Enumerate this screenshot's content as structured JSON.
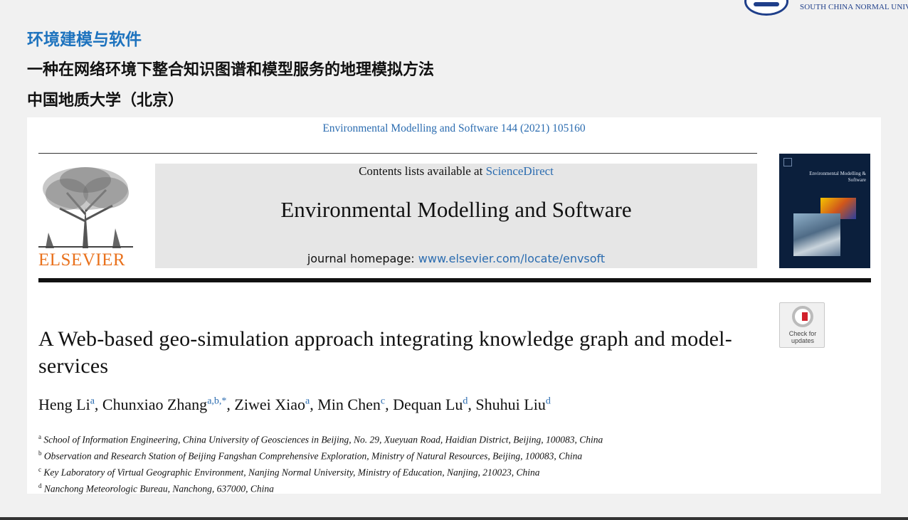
{
  "header": {
    "university": "SOUTH CHINA NORMAL UNIV",
    "category": "环境建模与软件",
    "title_cn": "一种在网络环境下整合知识图谱和模型服务的地理模拟方法",
    "institution": "中国地质大学（北京）"
  },
  "paper": {
    "journal_ref": "Environmental Modelling and Software 144 (2021) 105160",
    "contents_prefix": "Contents lists available at",
    "contents_link": "ScienceDirect",
    "journal_name": "Environmental Modelling and Software",
    "homepage_prefix": "journal homepage:",
    "homepage_link": "www.elsevier.com/locate/envsoft",
    "publisher": "ELSEVIER",
    "cover_title": "Environmental Modelling & Software",
    "crossmark_label": "Check for updates",
    "title": "A Web-based geo-simulation approach integrating knowledge graph and model-services",
    "authors": [
      {
        "name": "Heng Li",
        "sup": "a"
      },
      {
        "name": "Chunxiao Zhang",
        "sup": "a,b,*"
      },
      {
        "name": "Ziwei Xiao",
        "sup": "a"
      },
      {
        "name": "Min Chen",
        "sup": "c"
      },
      {
        "name": "Dequan Lu",
        "sup": "d"
      },
      {
        "name": "Shuhui Liu",
        "sup": "d"
      }
    ],
    "affiliations": [
      {
        "key": "a",
        "text": "School of Information Engineering, China University of Geosciences in Beijing, No. 29, Xueyuan Road, Haidian District, Beijing, 100083, China"
      },
      {
        "key": "b",
        "text": "Observation and Research Station of Beijing Fangshan Comprehensive Exploration, Ministry of Natural Resources, Beijing, 100083, China"
      },
      {
        "key": "c",
        "text": "Key Laboratory of Virtual Geographic Environment, Nanjing Normal University, Ministry of Education, Nanjing, 210023, China"
      },
      {
        "key": "d",
        "text": "Nanchong Meteorologic Bureau, Nanchong, 637000, China"
      }
    ]
  },
  "colors": {
    "category_blue": "#1e73be",
    "link_blue": "#2b6cb0",
    "elsevier_orange": "#e9711c"
  }
}
